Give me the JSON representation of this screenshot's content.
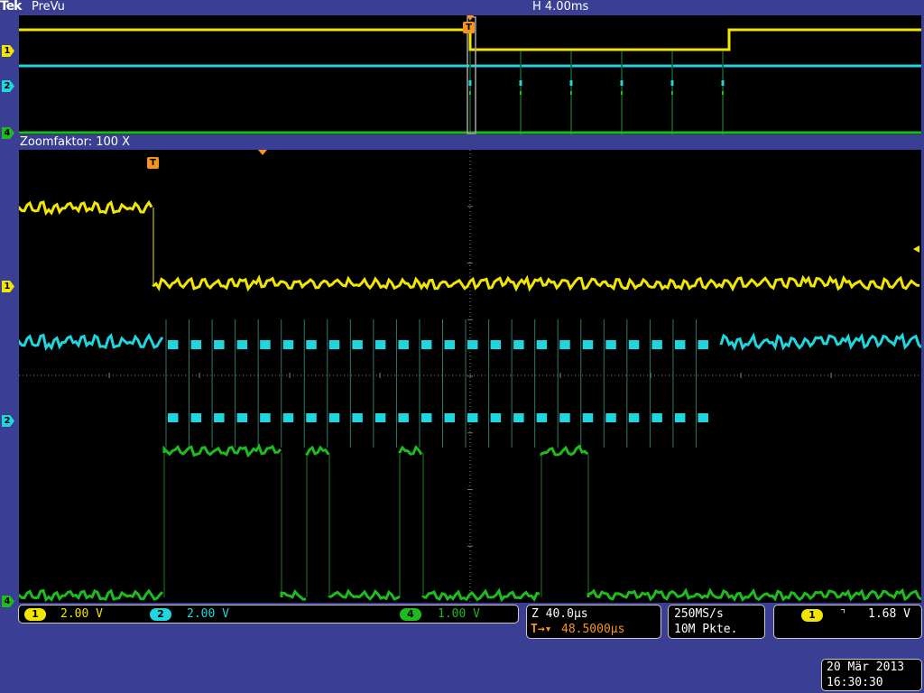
{
  "header": {
    "brand": "Tek",
    "mode": "PreVu",
    "horizontal_scale": "H 4.00ms"
  },
  "zoom": {
    "label": "Zoomfaktor: 100 X"
  },
  "markers": {
    "ch1": "1",
    "ch2": "2",
    "ch4": "4",
    "trigger": "T"
  },
  "channels": [
    {
      "id": "1",
      "scale": "2.00 V",
      "color": "#f2e600"
    },
    {
      "id": "2",
      "scale": "2.00 V",
      "color": "#1fd6de"
    },
    {
      "id": "4",
      "scale": "1.00 V",
      "color": "#1dbb1d"
    }
  ],
  "timebase": {
    "zoom_scale": "Z 40.0µs",
    "trigger_delay": "48.5000µs"
  },
  "acquisition": {
    "sample_rate": "250MS/s",
    "record_length": "10M Pkte."
  },
  "trigger": {
    "source": "1",
    "slope_symbol": "⌝",
    "level": "1.68 V"
  },
  "datetime": {
    "date": "20 Mär 2013",
    "time": "16:30:30"
  },
  "colors": {
    "ch1": "#f2e600",
    "ch2": "#1fd6de",
    "ch4": "#1dbb1d",
    "trigger": "#f7941d",
    "bezel": "#3a3f93"
  },
  "waveforms": {
    "overview": {
      "ch1": [
        {
          "x": 0,
          "level": "high"
        },
        {
          "x": 0.5,
          "level": "mid"
        },
        {
          "x": 0.787,
          "level": "high"
        }
      ],
      "ch2_pulses": [
        0.5,
        0.556,
        0.612,
        0.668,
        0.724,
        0.78
      ],
      "ch4": "low"
    },
    "zoomed": {
      "ch1": {
        "step_x": 0.149,
        "before": "high",
        "after": "low"
      },
      "ch2": {
        "burst_start": 0.161,
        "burst_end": 0.774,
        "bits": 24
      },
      "ch4_high_segments": [
        [
          0.161,
          0.291
        ],
        [
          0.319,
          0.344
        ],
        [
          0.422,
          0.448
        ],
        [
          0.579,
          0.631
        ]
      ]
    }
  }
}
